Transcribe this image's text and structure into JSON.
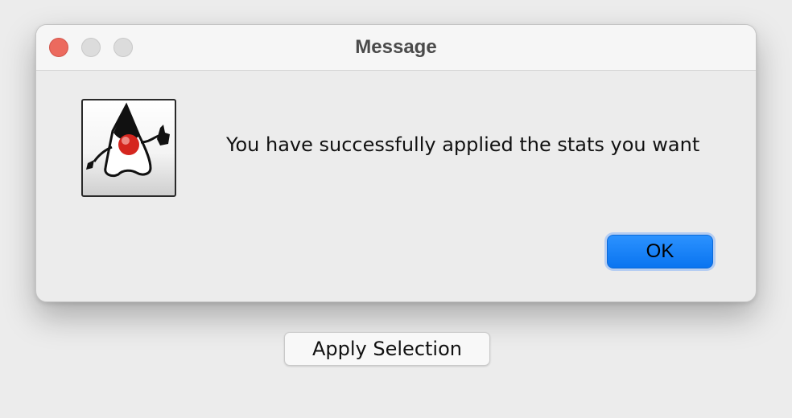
{
  "dialog": {
    "title": "Message",
    "message": "You have successfully applied the stats you want",
    "icon": "duke-icon",
    "ok_label": "OK",
    "window_controls": [
      "close",
      "minimize",
      "maximize"
    ]
  },
  "background": {
    "apply_label": "Apply Selection"
  },
  "colors": {
    "accent": "#0a74f0",
    "close": "#ec6a5e",
    "inactive_control": "#dcdcdc",
    "window_bg": "#ececec"
  }
}
